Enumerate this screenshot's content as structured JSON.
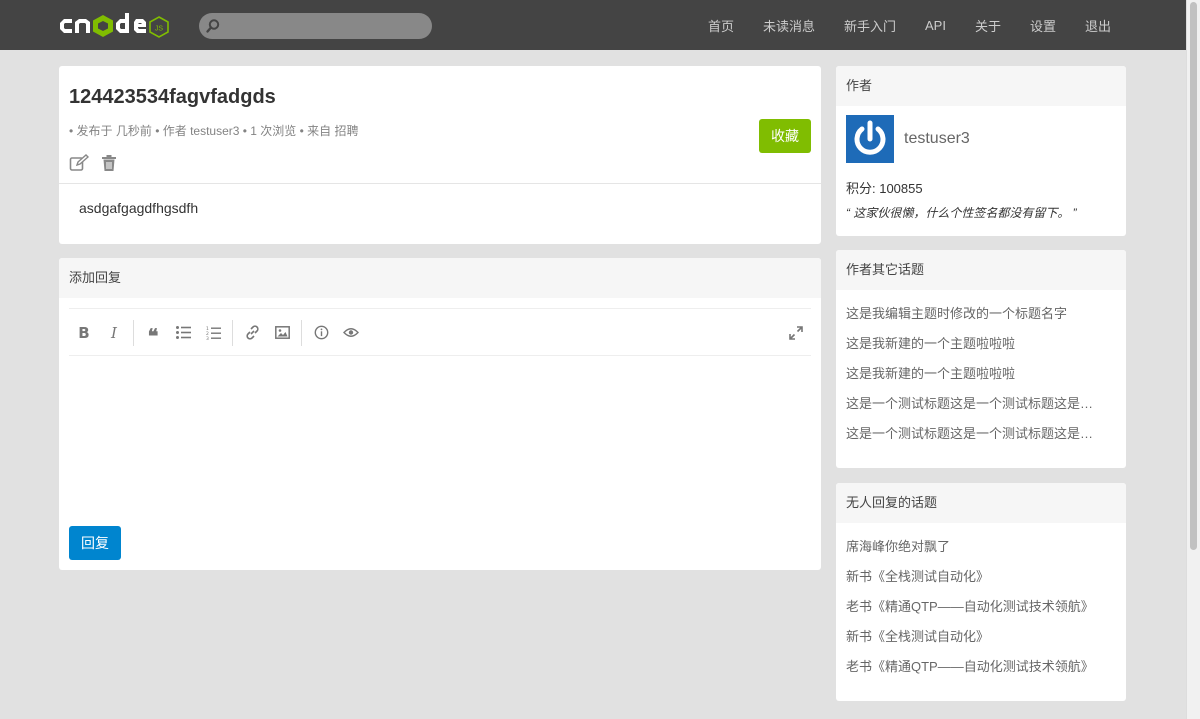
{
  "navbar": {
    "logo_text": "cnode",
    "logo_badge": "JS",
    "search_placeholder": "",
    "links": [
      {
        "label": "首页"
      },
      {
        "label": "未读消息"
      },
      {
        "label": "新手入门"
      },
      {
        "label": "API"
      },
      {
        "label": "关于"
      },
      {
        "label": "设置"
      },
      {
        "label": "退出"
      }
    ]
  },
  "topic": {
    "title": "124423534fagvfadgds",
    "meta": "• 发布于 几秒前 • 作者 testuser3 • 1 次浏览 • 来自 招聘",
    "collect_label": "收藏",
    "content": "asdgafgagdfhgsdfh",
    "edit_icon": "edit-icon",
    "delete_icon": "trash-icon"
  },
  "reply": {
    "header": "添加回复",
    "submit_label": "回复",
    "toolbar": [
      "bold",
      "italic",
      "quote",
      "unordered-list",
      "ordered-list",
      "link",
      "image",
      "info",
      "preview",
      "fullscreen"
    ]
  },
  "author": {
    "header": "作者",
    "name": "testuser3",
    "score": "积分: 100855",
    "signature": "“ 这家伙很懒，什么个性签名都没有留下。 ”"
  },
  "other_topics": {
    "header": "作者其它话题",
    "items": [
      "这是我编辑主题时修改的一个标题名字",
      "这是我新建的一个主题啦啦啦",
      "这是我新建的一个主题啦啦啦",
      "这是一个测试标题这是一个测试标题这是…",
      "这是一个测试标题这是一个测试标题这是…"
    ]
  },
  "no_reply_topics": {
    "header": "无人回复的话题",
    "items": [
      "席海峰你绝对飘了",
      "新书《全栈测试自动化》",
      "老书《精通QTP——自动化测试技术领航》",
      "新书《全栈测试自动化》",
      "老书《精通QTP——自动化测试技术领航》"
    ]
  },
  "colors": {
    "navbar": "#444444",
    "collect_button": "#80bd01",
    "reply_button": "#0085cf",
    "background": "#e1e1e1"
  }
}
